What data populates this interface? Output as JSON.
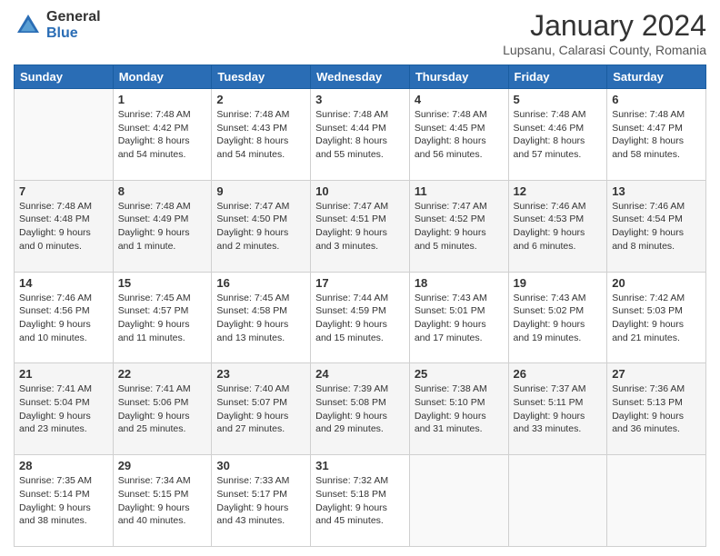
{
  "header": {
    "logo_general": "General",
    "logo_blue": "Blue",
    "month_title": "January 2024",
    "location": "Lupsanu, Calarasi County, Romania"
  },
  "weekdays": [
    "Sunday",
    "Monday",
    "Tuesday",
    "Wednesday",
    "Thursday",
    "Friday",
    "Saturday"
  ],
  "weeks": [
    [
      {
        "day": "",
        "sunrise": "",
        "sunset": "",
        "daylight": ""
      },
      {
        "day": "1",
        "sunrise": "Sunrise: 7:48 AM",
        "sunset": "Sunset: 4:42 PM",
        "daylight": "Daylight: 8 hours and 54 minutes."
      },
      {
        "day": "2",
        "sunrise": "Sunrise: 7:48 AM",
        "sunset": "Sunset: 4:43 PM",
        "daylight": "Daylight: 8 hours and 54 minutes."
      },
      {
        "day": "3",
        "sunrise": "Sunrise: 7:48 AM",
        "sunset": "Sunset: 4:44 PM",
        "daylight": "Daylight: 8 hours and 55 minutes."
      },
      {
        "day": "4",
        "sunrise": "Sunrise: 7:48 AM",
        "sunset": "Sunset: 4:45 PM",
        "daylight": "Daylight: 8 hours and 56 minutes."
      },
      {
        "day": "5",
        "sunrise": "Sunrise: 7:48 AM",
        "sunset": "Sunset: 4:46 PM",
        "daylight": "Daylight: 8 hours and 57 minutes."
      },
      {
        "day": "6",
        "sunrise": "Sunrise: 7:48 AM",
        "sunset": "Sunset: 4:47 PM",
        "daylight": "Daylight: 8 hours and 58 minutes."
      }
    ],
    [
      {
        "day": "7",
        "sunrise": "Sunrise: 7:48 AM",
        "sunset": "Sunset: 4:48 PM",
        "daylight": "Daylight: 9 hours and 0 minutes."
      },
      {
        "day": "8",
        "sunrise": "Sunrise: 7:48 AM",
        "sunset": "Sunset: 4:49 PM",
        "daylight": "Daylight: 9 hours and 1 minute."
      },
      {
        "day": "9",
        "sunrise": "Sunrise: 7:47 AM",
        "sunset": "Sunset: 4:50 PM",
        "daylight": "Daylight: 9 hours and 2 minutes."
      },
      {
        "day": "10",
        "sunrise": "Sunrise: 7:47 AM",
        "sunset": "Sunset: 4:51 PM",
        "daylight": "Daylight: 9 hours and 3 minutes."
      },
      {
        "day": "11",
        "sunrise": "Sunrise: 7:47 AM",
        "sunset": "Sunset: 4:52 PM",
        "daylight": "Daylight: 9 hours and 5 minutes."
      },
      {
        "day": "12",
        "sunrise": "Sunrise: 7:46 AM",
        "sunset": "Sunset: 4:53 PM",
        "daylight": "Daylight: 9 hours and 6 minutes."
      },
      {
        "day": "13",
        "sunrise": "Sunrise: 7:46 AM",
        "sunset": "Sunset: 4:54 PM",
        "daylight": "Daylight: 9 hours and 8 minutes."
      }
    ],
    [
      {
        "day": "14",
        "sunrise": "Sunrise: 7:46 AM",
        "sunset": "Sunset: 4:56 PM",
        "daylight": "Daylight: 9 hours and 10 minutes."
      },
      {
        "day": "15",
        "sunrise": "Sunrise: 7:45 AM",
        "sunset": "Sunset: 4:57 PM",
        "daylight": "Daylight: 9 hours and 11 minutes."
      },
      {
        "day": "16",
        "sunrise": "Sunrise: 7:45 AM",
        "sunset": "Sunset: 4:58 PM",
        "daylight": "Daylight: 9 hours and 13 minutes."
      },
      {
        "day": "17",
        "sunrise": "Sunrise: 7:44 AM",
        "sunset": "Sunset: 4:59 PM",
        "daylight": "Daylight: 9 hours and 15 minutes."
      },
      {
        "day": "18",
        "sunrise": "Sunrise: 7:43 AM",
        "sunset": "Sunset: 5:01 PM",
        "daylight": "Daylight: 9 hours and 17 minutes."
      },
      {
        "day": "19",
        "sunrise": "Sunrise: 7:43 AM",
        "sunset": "Sunset: 5:02 PM",
        "daylight": "Daylight: 9 hours and 19 minutes."
      },
      {
        "day": "20",
        "sunrise": "Sunrise: 7:42 AM",
        "sunset": "Sunset: 5:03 PM",
        "daylight": "Daylight: 9 hours and 21 minutes."
      }
    ],
    [
      {
        "day": "21",
        "sunrise": "Sunrise: 7:41 AM",
        "sunset": "Sunset: 5:04 PM",
        "daylight": "Daylight: 9 hours and 23 minutes."
      },
      {
        "day": "22",
        "sunrise": "Sunrise: 7:41 AM",
        "sunset": "Sunset: 5:06 PM",
        "daylight": "Daylight: 9 hours and 25 minutes."
      },
      {
        "day": "23",
        "sunrise": "Sunrise: 7:40 AM",
        "sunset": "Sunset: 5:07 PM",
        "daylight": "Daylight: 9 hours and 27 minutes."
      },
      {
        "day": "24",
        "sunrise": "Sunrise: 7:39 AM",
        "sunset": "Sunset: 5:08 PM",
        "daylight": "Daylight: 9 hours and 29 minutes."
      },
      {
        "day": "25",
        "sunrise": "Sunrise: 7:38 AM",
        "sunset": "Sunset: 5:10 PM",
        "daylight": "Daylight: 9 hours and 31 minutes."
      },
      {
        "day": "26",
        "sunrise": "Sunrise: 7:37 AM",
        "sunset": "Sunset: 5:11 PM",
        "daylight": "Daylight: 9 hours and 33 minutes."
      },
      {
        "day": "27",
        "sunrise": "Sunrise: 7:36 AM",
        "sunset": "Sunset: 5:13 PM",
        "daylight": "Daylight: 9 hours and 36 minutes."
      }
    ],
    [
      {
        "day": "28",
        "sunrise": "Sunrise: 7:35 AM",
        "sunset": "Sunset: 5:14 PM",
        "daylight": "Daylight: 9 hours and 38 minutes."
      },
      {
        "day": "29",
        "sunrise": "Sunrise: 7:34 AM",
        "sunset": "Sunset: 5:15 PM",
        "daylight": "Daylight: 9 hours and 40 minutes."
      },
      {
        "day": "30",
        "sunrise": "Sunrise: 7:33 AM",
        "sunset": "Sunset: 5:17 PM",
        "daylight": "Daylight: 9 hours and 43 minutes."
      },
      {
        "day": "31",
        "sunrise": "Sunrise: 7:32 AM",
        "sunset": "Sunset: 5:18 PM",
        "daylight": "Daylight: 9 hours and 45 minutes."
      },
      {
        "day": "",
        "sunrise": "",
        "sunset": "",
        "daylight": ""
      },
      {
        "day": "",
        "sunrise": "",
        "sunset": "",
        "daylight": ""
      },
      {
        "day": "",
        "sunrise": "",
        "sunset": "",
        "daylight": ""
      }
    ]
  ]
}
